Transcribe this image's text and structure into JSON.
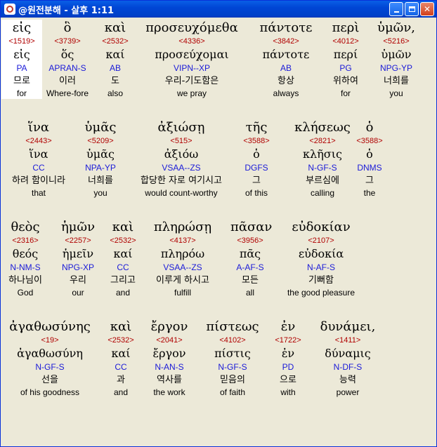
{
  "window": {
    "title": "@원전분해 - 살후 1:11",
    "buttons": [
      "minimize",
      "maximize",
      "close"
    ]
  },
  "colors": {
    "strong": "#b00000",
    "morph": "#1a1ad8",
    "titlebar": "#0046d5",
    "background": "#ece9d8"
  },
  "lines": [
    [
      {
        "greek": "εἰς",
        "strong": "<1519>",
        "lemma": "εἰς",
        "morph": "PA",
        "korean": "므로",
        "english": "for",
        "selected": true
      },
      {
        "greek": "ὃ",
        "strong": "<3739>",
        "lemma": "ὅς",
        "morph": "APRAN-S",
        "korean": "이러",
        "english": "Where-fore"
      },
      {
        "greek": "καὶ",
        "strong": "<2532>",
        "lemma": "καί",
        "morph": "AB",
        "korean": "도",
        "english": "also"
      },
      {
        "greek": "προσευχόμεθα",
        "strong": "<4336>",
        "lemma": "προσεύχομαι",
        "morph": "VIPN--XP",
        "korean": "우리-기도함은",
        "english": "we pray"
      },
      {
        "greek": "πάντοτε",
        "strong": "<3842>",
        "lemma": "πάντοτε",
        "morph": "AB",
        "korean": "항상",
        "english": "always"
      },
      {
        "greek": "περὶ",
        "strong": "<4012>",
        "lemma": "περί",
        "morph": "PG",
        "korean": "위하여",
        "english": "for"
      },
      {
        "greek": "ὑμῶν,",
        "strong": "<5216>",
        "lemma": "ὑμῶν",
        "morph": "NPG-YP",
        "korean": "너희를",
        "english": "you"
      }
    ],
    [
      {
        "greek": "ἵνα",
        "strong": "<2443>",
        "lemma": "ἵνα",
        "morph": "CC",
        "korean": "하려 함이니라",
        "english": "that"
      },
      {
        "greek": "ὑμᾶς",
        "strong": "<5209>",
        "lemma": "ὑμᾶς",
        "morph": "NPA-YP",
        "korean": "너희를",
        "english": "you"
      },
      {
        "greek": "ἀξιώσῃ",
        "strong": "<515>",
        "lemma": "ἀξιόω",
        "morph": "VSAA--ZS",
        "korean": "합당한 자로 여기시고",
        "english": "would count-worthy"
      },
      {
        "greek": "τῆς",
        "strong": "<3588>",
        "lemma": "ὁ",
        "morph": "DGFS",
        "korean": "그",
        "english": "of this"
      },
      {
        "greek": "κλήσεως",
        "strong": "<2821>",
        "lemma": "κλῆσις",
        "morph": "N-GF-S",
        "korean": "부르심에",
        "english": "calling"
      },
      {
        "greek": "ὁ",
        "strong": "<3588>",
        "lemma": "ὁ",
        "morph": "DNMS",
        "korean": "그",
        "english": "the"
      }
    ],
    [
      {
        "greek": "θεὸς",
        "strong": "<2316>",
        "lemma": "θεός",
        "morph": "N-NM-S",
        "korean": "하나님이",
        "english": "God"
      },
      {
        "greek": "ἡμῶν",
        "strong": "<2257>",
        "lemma": "ἡμεῖν",
        "morph": "NPG-XP",
        "korean": "우리",
        "english": "our"
      },
      {
        "greek": "καὶ",
        "strong": "<2532>",
        "lemma": "καί",
        "morph": "CC",
        "korean": "그리고",
        "english": "and"
      },
      {
        "greek": "πληρώσῃ",
        "strong": "<4137>",
        "lemma": "πληρόω",
        "morph": "VSAA--ZS",
        "korean": "이루게 하시고",
        "english": "fulfill"
      },
      {
        "greek": "πᾶσαν",
        "strong": "<3956>",
        "lemma": "πᾶς",
        "morph": "A-AF-S",
        "korean": "모든",
        "english": "all"
      },
      {
        "greek": "εὐδοκίαν",
        "strong": "<2107>",
        "lemma": "εὐδοκία",
        "morph": "N-AF-S",
        "korean": "기뻐함",
        "english": "the good pleasure"
      }
    ],
    [
      {
        "greek": "ἀγαθωσύνης",
        "strong": "<19>",
        "lemma": "ἀγαθωσύνη",
        "morph": "N-GF-S",
        "korean": "선을",
        "english": "of his goodness"
      },
      {
        "greek": "καὶ",
        "strong": "<2532>",
        "lemma": "καί",
        "morph": "CC",
        "korean": "과",
        "english": "and"
      },
      {
        "greek": "ἔργον",
        "strong": "<2041>",
        "lemma": "ἔργον",
        "morph": "N-AN-S",
        "korean": "역사를",
        "english": "the work"
      },
      {
        "greek": "πίστεως",
        "strong": "<4102>",
        "lemma": "πίστις",
        "morph": "N-GF-S",
        "korean": "믿음의",
        "english": "of faith"
      },
      {
        "greek": "ἐν",
        "strong": "<1722>",
        "lemma": "ἐν",
        "morph": "PD",
        "korean": "으로",
        "english": "with"
      },
      {
        "greek": "δυνάμει,",
        "strong": "<1411>",
        "lemma": "δύναμις",
        "morph": "N-DF-S",
        "korean": "능력",
        "english": "power"
      }
    ]
  ]
}
